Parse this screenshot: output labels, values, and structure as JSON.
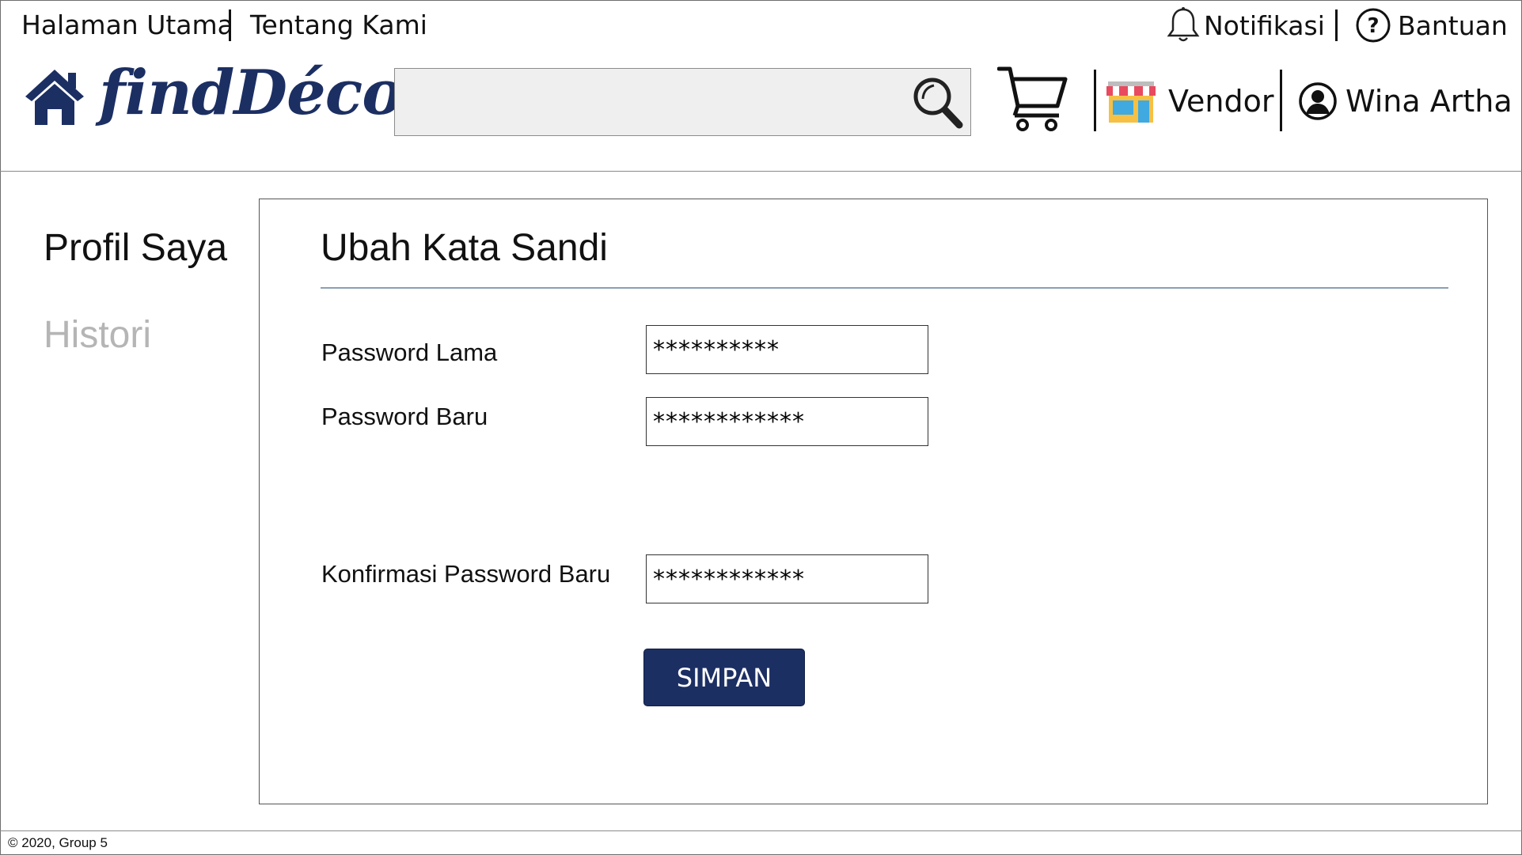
{
  "header": {
    "top_links": [
      "Halaman Utama",
      "Tentang Kami"
    ],
    "notifications_label": "Notifikasi",
    "help_label": "Bantuan",
    "logo_text": "findDécor",
    "search": {
      "value": "",
      "placeholder": ""
    },
    "vendor_label": "Vendor",
    "user_name": "Wina Artha",
    "brand_color": "#1c2f63"
  },
  "sidebar": {
    "items": [
      {
        "label": "Profil Saya",
        "active": true
      },
      {
        "label": "Histori",
        "active": false
      }
    ]
  },
  "main": {
    "title": "Ubah Kata Sandi",
    "fields": [
      {
        "label": "Password Lama",
        "value": "**********"
      },
      {
        "label": "Password Baru",
        "value": "************"
      },
      {
        "label": "Konfirmasi Password Baru",
        "value": "************"
      }
    ],
    "save_label": "SIMPAN"
  },
  "footer": {
    "text": "© 2020, Group 5"
  },
  "icons": [
    "home-icon",
    "search-icon",
    "cart-icon",
    "store-icon",
    "bell-icon",
    "help-icon",
    "user-icon"
  ]
}
